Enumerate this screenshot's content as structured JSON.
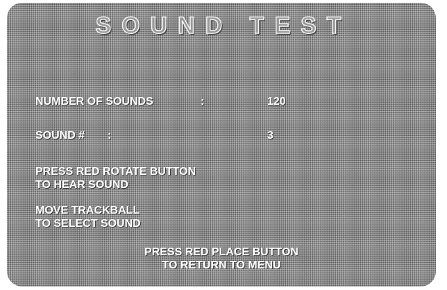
{
  "screen": {
    "title": "SOUND TEST",
    "number_of_sounds": {
      "label": "NUMBER OF SOUNDS",
      "separator": ":",
      "value": "120"
    },
    "sound_number": {
      "label": "SOUND #",
      "separator": ":",
      "value": "3"
    },
    "instructions": {
      "rotate_line1": "PRESS RED ROTATE BUTTON",
      "rotate_line2": "TO HEAR SOUND",
      "trackball_line1": "MOVE TRACKBALL",
      "trackball_line2": "TO SELECT SOUND",
      "place_line1": "PRESS RED PLACE BUTTON",
      "place_line2": "TO RETURN TO MENU"
    }
  }
}
